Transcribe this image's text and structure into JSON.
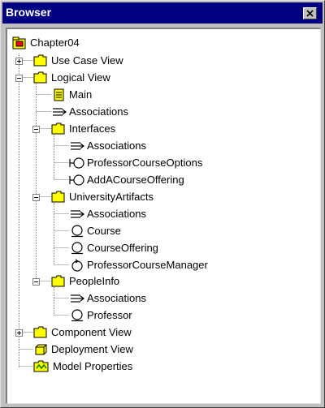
{
  "window": {
    "title": "Browser"
  },
  "tree": {
    "root": {
      "label": "Chapter04",
      "icon": "model-root-icon"
    },
    "use_case_view": {
      "label": "Use Case View",
      "icon": "folder-icon",
      "state": "collapsed"
    },
    "logical_view": {
      "label": "Logical View",
      "icon": "folder-icon",
      "state": "expanded",
      "main": {
        "label": "Main",
        "icon": "class-diagram-icon"
      },
      "associations": {
        "label": "Associations",
        "icon": "associations-icon"
      },
      "interfaces": {
        "label": "Interfaces",
        "icon": "folder-icon",
        "state": "expanded",
        "associations": {
          "label": "Associations",
          "icon": "associations-icon"
        },
        "professor_course_options": {
          "label": "ProfessorCourseOptions",
          "icon": "interface-icon"
        },
        "add_a_course_offering": {
          "label": "AddACourseOffering",
          "icon": "interface-icon"
        }
      },
      "university_artifacts": {
        "label": "UniversityArtifacts",
        "icon": "folder-icon",
        "state": "expanded",
        "associations": {
          "label": "Associations",
          "icon": "associations-icon"
        },
        "course": {
          "label": "Course",
          "icon": "entity-class-icon"
        },
        "course_offering": {
          "label": "CourseOffering",
          "icon": "entity-class-icon"
        },
        "professor_course_manager": {
          "label": "ProfessorCourseManager",
          "icon": "control-class-icon"
        }
      },
      "people_info": {
        "label": "PeopleInfo",
        "icon": "folder-icon",
        "state": "expanded",
        "associations": {
          "label": "Associations",
          "icon": "associations-icon"
        },
        "professor": {
          "label": "Professor",
          "icon": "entity-class-icon"
        }
      }
    },
    "component_view": {
      "label": "Component View",
      "icon": "folder-icon",
      "state": "collapsed"
    },
    "deployment_view": {
      "label": "Deployment View",
      "icon": "deployment-icon"
    },
    "model_properties": {
      "label": "Model Properties",
      "icon": "model-properties-icon"
    }
  },
  "colors": {
    "title_bar": "#000080",
    "title_text": "#ffffff",
    "window_face": "#c0c0c0",
    "tree_background": "#ffffff",
    "folder_fill": "#ffff00",
    "tree_line": "#808080"
  }
}
